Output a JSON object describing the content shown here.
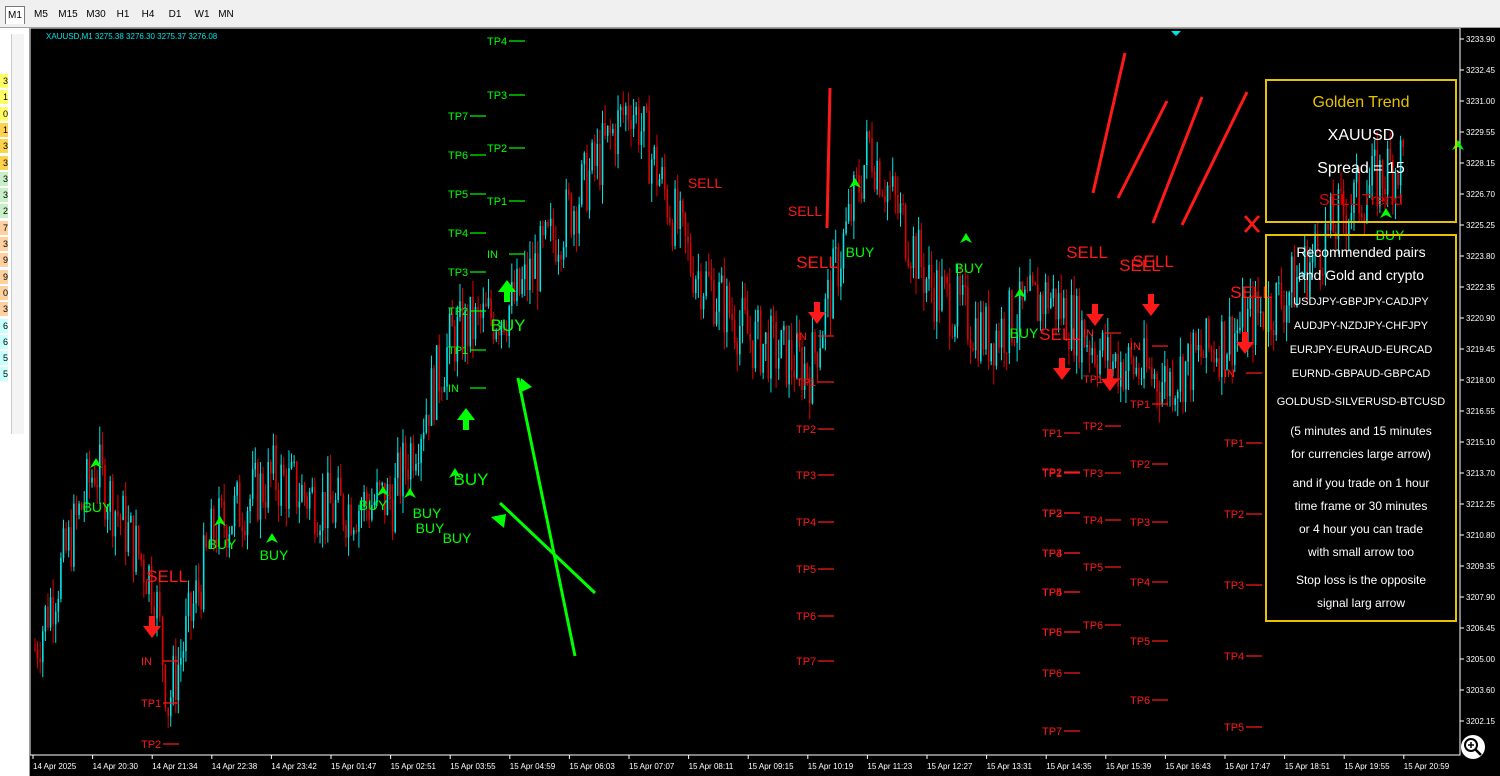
{
  "timeframes": [
    "M1",
    "M5",
    "M15",
    "M30",
    "H1",
    "H4",
    "D1",
    "W1",
    "MN"
  ],
  "active_timeframe": "M1",
  "left_panel_digits": [
    "3",
    "1",
    "0",
    "1",
    "3",
    "3",
    "3",
    "3",
    "2",
    "7",
    "3",
    "9",
    "9",
    "0",
    "3",
    "6",
    "6",
    "5",
    "5"
  ],
  "chart_header": "XAUUSD,M1  3275.38 3276.30 3275.37 3276.08",
  "price_labels": [
    "3233.90",
    "3232.45",
    "3231.00",
    "3229.55",
    "3228.15",
    "3226.70",
    "3225.25",
    "3223.80",
    "3222.35",
    "3220.90",
    "3219.45",
    "3218.00",
    "3216.55",
    "3215.10",
    "3213.70",
    "3212.25",
    "3210.80",
    "3209.35",
    "3207.90",
    "3206.45",
    "3205.00",
    "3203.60",
    "3202.15"
  ],
  "time_labels": [
    "14 Apr 2025",
    "14 Apr 20:30",
    "14 Apr 21:34",
    "14 Apr 22:38",
    "14 Apr 23:42",
    "15 Apr 01:47",
    "15 Apr 02:51",
    "15 Apr 03:55",
    "15 Apr 04:59",
    "15 Apr 06:03",
    "15 Apr 07:07",
    "15 Apr 08:11",
    "15 Apr 09:15",
    "15 Apr 10:19",
    "15 Apr 11:23",
    "15 Apr 12:27",
    "15 Apr 13:31",
    "15 Apr 14:35",
    "15 Apr 15:39",
    "15 Apr 16:43",
    "15 Apr 17:47",
    "15 Apr 18:51",
    "15 Apr 19:55",
    "15 Apr 20:59"
  ],
  "colors": {
    "bull": "#00e5e5",
    "bear": "#e00000",
    "buy": "#00ff00",
    "sell": "#ff1a1a",
    "frame": "#e6c200",
    "bg": "#000000"
  },
  "chart_data": {
    "type": "candlestick",
    "symbol": "XAUUSD",
    "timeframe": "M1",
    "ylim": [
      3201.5,
      3234.5
    ],
    "xlabel": "",
    "ylabel": "",
    "trend": [
      {
        "t": "14 Apr 2025",
        "p": 3205.5
      },
      {
        "t": "14 Apr 20:30",
        "p": 3214.0
      },
      {
        "t": "14 Apr 21:34",
        "p": 3208.5
      },
      {
        "t": "14 Apr 21:34",
        "p": 3203.0
      },
      {
        "t": "14 Apr 22:38",
        "p": 3211.0
      },
      {
        "t": "14 Apr 23:42",
        "p": 3213.5
      },
      {
        "t": "15 Apr 01:47",
        "p": 3212.0
      },
      {
        "t": "15 Apr 02:51",
        "p": 3212.5
      },
      {
        "t": "15 Apr 03:55",
        "p": 3220.0
      },
      {
        "t": "15 Apr 04:59",
        "p": 3221.5
      },
      {
        "t": "15 Apr 06:03",
        "p": 3226.0
      },
      {
        "t": "15 Apr 07:07",
        "p": 3231.0
      },
      {
        "t": "15 Apr 08:11",
        "p": 3223.5
      },
      {
        "t": "15 Apr 09:15",
        "p": 3220.0
      },
      {
        "t": "15 Apr 10:19",
        "p": 3218.5
      },
      {
        "t": "15 Apr 11:23",
        "p": 3229.0
      },
      {
        "t": "15 Apr 12:27",
        "p": 3222.5
      },
      {
        "t": "15 Apr 13:31",
        "p": 3220.0
      },
      {
        "t": "15 Apr 14:35",
        "p": 3222.0
      },
      {
        "t": "15 Apr 15:39",
        "p": 3219.0
      },
      {
        "t": "15 Apr 16:43",
        "p": 3218.0
      },
      {
        "t": "15 Apr 17:47",
        "p": 3220.0
      },
      {
        "t": "15 Apr 18:51",
        "p": 3222.0
      },
      {
        "t": "15 Apr 19:55",
        "p": 3226.0
      },
      {
        "t": "15 Apr 20:59",
        "p": 3228.5
      }
    ],
    "signal_texts": [
      {
        "text": "BUY",
        "kind": "buy",
        "size": "s"
      },
      {
        "text": "BUY",
        "kind": "buy",
        "size": "s"
      },
      {
        "text": "BUY",
        "kind": "buy",
        "size": "s"
      },
      {
        "text": "BUY",
        "kind": "buy",
        "size": "s"
      },
      {
        "text": "BUY",
        "kind": "buy",
        "size": "s"
      },
      {
        "text": "BUY",
        "kind": "buy",
        "size": "s"
      },
      {
        "text": "BUY",
        "kind": "buy",
        "size": "s"
      },
      {
        "text": "BUY",
        "kind": "buy",
        "size": "l"
      },
      {
        "text": "BUY",
        "kind": "buy",
        "size": "l"
      },
      {
        "text": "BUY",
        "kind": "buy",
        "size": "s"
      },
      {
        "text": "BUY",
        "kind": "buy",
        "size": "s"
      },
      {
        "text": "BUY",
        "kind": "buy",
        "size": "s"
      },
      {
        "text": "BUY",
        "kind": "buy",
        "size": "s"
      },
      {
        "text": "SELL",
        "kind": "sell",
        "size": "l"
      },
      {
        "text": "SELL",
        "kind": "sell",
        "size": "m"
      },
      {
        "text": "SELL",
        "kind": "sell",
        "size": "m"
      },
      {
        "text": "SELL",
        "kind": "sell",
        "size": "l"
      },
      {
        "text": "SELL",
        "kind": "sell",
        "size": "l"
      },
      {
        "text": "SELL",
        "kind": "sell",
        "size": "l"
      },
      {
        "text": "SELL",
        "kind": "sell",
        "size": "l"
      },
      {
        "text": "SELL",
        "kind": "sell",
        "size": "l"
      },
      {
        "text": "SELL",
        "kind": "sell",
        "size": "l"
      }
    ],
    "buy_levels_a": [
      "TP7",
      "TP6",
      "TP5",
      "TP4",
      "TP3",
      "TP2",
      "TP1",
      "IN"
    ],
    "buy_levels_b": [
      "TP4",
      "TP3",
      "TP2",
      "TP1",
      "IN"
    ],
    "sell_levels_a": [
      "IN",
      "TP1",
      "TP2"
    ],
    "sell_levels_b": [
      "IN",
      "TP1",
      "TP2",
      "TP3",
      "TP4",
      "TP5",
      "TP6",
      "TP7"
    ],
    "sell_levels_c": [
      "TP1",
      "TP2",
      "TP3",
      "TP4",
      "TP5",
      "TP6"
    ],
    "sell_levels_d": [
      "TP1",
      "TP2",
      "TP3",
      "TP4",
      "TP5",
      "TP6",
      "TP7"
    ],
    "sell_levels_e": [
      "IN",
      "TP1",
      "TP2",
      "TP3",
      "TP4",
      "TP5",
      "TP6"
    ],
    "sell_levels_f": [
      "IN",
      "TP1",
      "TP2",
      "TP3",
      "TP4",
      "TP5",
      "TP6"
    ],
    "sell_levels_g": [
      "IN",
      "TP1",
      "TP2",
      "TP3",
      "TP4",
      "TP5"
    ],
    "cross_mark": "X"
  },
  "golden_panel": {
    "title": "Golden Trend",
    "symbol": "XAUUSD",
    "spread": "Spread = 15",
    "trend": "SELL Trend"
  },
  "info_panel": {
    "lines": [
      "Recommended pairs",
      "and Gold and crypto",
      "USDJPY-GBPJPY-CADJPY",
      "AUDJPY-NZDJPY-CHFJPY",
      "EURJPY-EURAUD-EURCAD",
      "EURND-GBPAUD-GBPCAD",
      "GOLDUSD-SILVERUSD-BTCUSD",
      "(5 minutes and 15 minutes",
      "for currencies large arrow)",
      "and if you trade on 1 hour",
      "time frame or 30 minutes",
      "or 4 hour you can trade",
      "with small arrow too",
      "Stop loss is the opposite",
      "signal larg arrow"
    ]
  }
}
